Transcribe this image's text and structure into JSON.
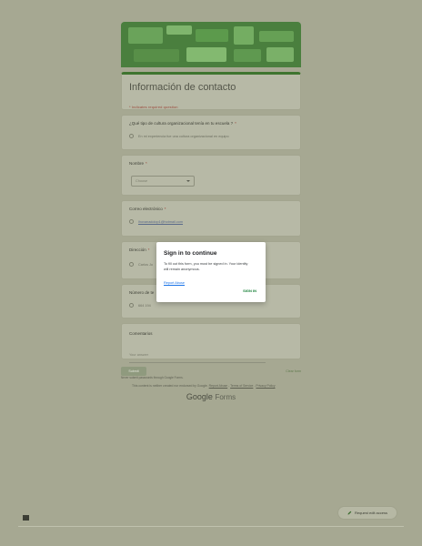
{
  "form": {
    "title": "Información de contacto",
    "required_note": "* Indicates required question"
  },
  "questions": [
    {
      "label": "¿Qué tipo de cultura organizacional tenía en tu escuela ?",
      "required_mark": "*",
      "option": "En mi experiencia fue una cultura organizacional en equipo"
    },
    {
      "label": "Nombre",
      "required_mark": "*",
      "select_value": "Choose"
    },
    {
      "label": "Correo electrónico",
      "required_mark": "*",
      "option": "lhovanadolop1@hotmail.com"
    },
    {
      "label": "Dirección",
      "required_mark": "*",
      "option": "Carlos Jo"
    },
    {
      "label": "Número de te",
      "option": "664 194"
    },
    {
      "label": "Comentarios",
      "placeholder": "Your answer"
    }
  ],
  "footer": {
    "submit": "Submit",
    "clear": "Clear form",
    "never_note": "Never submit passwords through Google Forms.",
    "disclaimer_prefix": "This content is neither created nor endorsed by Google.",
    "disclaimer_links": [
      "Report Abuse",
      "Terms of Service",
      "Privacy Policy"
    ],
    "logo_google": "Google",
    "logo_forms": "Forms"
  },
  "request_edit": {
    "label": "Request edit access"
  },
  "dialog": {
    "title": "Sign in to continue",
    "body": "To fill out this form, you must be signed in. Your identity will remain anonymous.",
    "report": "Report Abuse",
    "sign_in": "SIGN IN"
  },
  "colors": {
    "overlay": "#a6a892",
    "accent_green": "#3f7430",
    "sign_in_green": "#188038"
  }
}
